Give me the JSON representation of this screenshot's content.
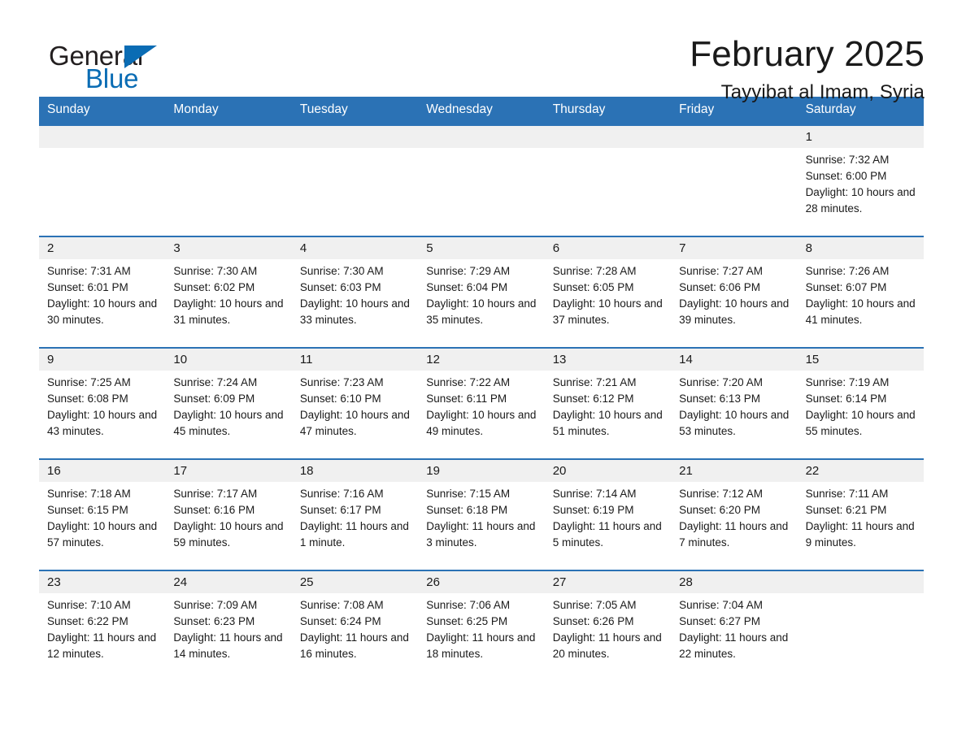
{
  "brand": {
    "name_part1": "General",
    "name_part2": "Blue",
    "logo_icon": "triangle-logo-icon"
  },
  "header": {
    "month_title": "February 2025",
    "location": "Tayyibat al Imam, Syria"
  },
  "colors": {
    "header_blue": "#2b72b5",
    "brand_blue": "#0a6cb4",
    "date_band": "#f0f0f0",
    "text": "#1a1a1a"
  },
  "weekdays": [
    "Sunday",
    "Monday",
    "Tuesday",
    "Wednesday",
    "Thursday",
    "Friday",
    "Saturday"
  ],
  "labels": {
    "sunrise_prefix": "Sunrise:",
    "sunset_prefix": "Sunset:",
    "daylight_prefix": "Daylight:"
  },
  "weeks": [
    [
      {
        "date": "",
        "sunrise": "",
        "sunset": "",
        "daylight": ""
      },
      {
        "date": "",
        "sunrise": "",
        "sunset": "",
        "daylight": ""
      },
      {
        "date": "",
        "sunrise": "",
        "sunset": "",
        "daylight": ""
      },
      {
        "date": "",
        "sunrise": "",
        "sunset": "",
        "daylight": ""
      },
      {
        "date": "",
        "sunrise": "",
        "sunset": "",
        "daylight": ""
      },
      {
        "date": "",
        "sunrise": "",
        "sunset": "",
        "daylight": ""
      },
      {
        "date": "1",
        "sunrise": "Sunrise: 7:32 AM",
        "sunset": "Sunset: 6:00 PM",
        "daylight": "Daylight: 10 hours and 28 minutes."
      }
    ],
    [
      {
        "date": "2",
        "sunrise": "Sunrise: 7:31 AM",
        "sunset": "Sunset: 6:01 PM",
        "daylight": "Daylight: 10 hours and 30 minutes."
      },
      {
        "date": "3",
        "sunrise": "Sunrise: 7:30 AM",
        "sunset": "Sunset: 6:02 PM",
        "daylight": "Daylight: 10 hours and 31 minutes."
      },
      {
        "date": "4",
        "sunrise": "Sunrise: 7:30 AM",
        "sunset": "Sunset: 6:03 PM",
        "daylight": "Daylight: 10 hours and 33 minutes."
      },
      {
        "date": "5",
        "sunrise": "Sunrise: 7:29 AM",
        "sunset": "Sunset: 6:04 PM",
        "daylight": "Daylight: 10 hours and 35 minutes."
      },
      {
        "date": "6",
        "sunrise": "Sunrise: 7:28 AM",
        "sunset": "Sunset: 6:05 PM",
        "daylight": "Daylight: 10 hours and 37 minutes."
      },
      {
        "date": "7",
        "sunrise": "Sunrise: 7:27 AM",
        "sunset": "Sunset: 6:06 PM",
        "daylight": "Daylight: 10 hours and 39 minutes."
      },
      {
        "date": "8",
        "sunrise": "Sunrise: 7:26 AM",
        "sunset": "Sunset: 6:07 PM",
        "daylight": "Daylight: 10 hours and 41 minutes."
      }
    ],
    [
      {
        "date": "9",
        "sunrise": "Sunrise: 7:25 AM",
        "sunset": "Sunset: 6:08 PM",
        "daylight": "Daylight: 10 hours and 43 minutes."
      },
      {
        "date": "10",
        "sunrise": "Sunrise: 7:24 AM",
        "sunset": "Sunset: 6:09 PM",
        "daylight": "Daylight: 10 hours and 45 minutes."
      },
      {
        "date": "11",
        "sunrise": "Sunrise: 7:23 AM",
        "sunset": "Sunset: 6:10 PM",
        "daylight": "Daylight: 10 hours and 47 minutes."
      },
      {
        "date": "12",
        "sunrise": "Sunrise: 7:22 AM",
        "sunset": "Sunset: 6:11 PM",
        "daylight": "Daylight: 10 hours and 49 minutes."
      },
      {
        "date": "13",
        "sunrise": "Sunrise: 7:21 AM",
        "sunset": "Sunset: 6:12 PM",
        "daylight": "Daylight: 10 hours and 51 minutes."
      },
      {
        "date": "14",
        "sunrise": "Sunrise: 7:20 AM",
        "sunset": "Sunset: 6:13 PM",
        "daylight": "Daylight: 10 hours and 53 minutes."
      },
      {
        "date": "15",
        "sunrise": "Sunrise: 7:19 AM",
        "sunset": "Sunset: 6:14 PM",
        "daylight": "Daylight: 10 hours and 55 minutes."
      }
    ],
    [
      {
        "date": "16",
        "sunrise": "Sunrise: 7:18 AM",
        "sunset": "Sunset: 6:15 PM",
        "daylight": "Daylight: 10 hours and 57 minutes."
      },
      {
        "date": "17",
        "sunrise": "Sunrise: 7:17 AM",
        "sunset": "Sunset: 6:16 PM",
        "daylight": "Daylight: 10 hours and 59 minutes."
      },
      {
        "date": "18",
        "sunrise": "Sunrise: 7:16 AM",
        "sunset": "Sunset: 6:17 PM",
        "daylight": "Daylight: 11 hours and 1 minute."
      },
      {
        "date": "19",
        "sunrise": "Sunrise: 7:15 AM",
        "sunset": "Sunset: 6:18 PM",
        "daylight": "Daylight: 11 hours and 3 minutes."
      },
      {
        "date": "20",
        "sunrise": "Sunrise: 7:14 AM",
        "sunset": "Sunset: 6:19 PM",
        "daylight": "Daylight: 11 hours and 5 minutes."
      },
      {
        "date": "21",
        "sunrise": "Sunrise: 7:12 AM",
        "sunset": "Sunset: 6:20 PM",
        "daylight": "Daylight: 11 hours and 7 minutes."
      },
      {
        "date": "22",
        "sunrise": "Sunrise: 7:11 AM",
        "sunset": "Sunset: 6:21 PM",
        "daylight": "Daylight: 11 hours and 9 minutes."
      }
    ],
    [
      {
        "date": "23",
        "sunrise": "Sunrise: 7:10 AM",
        "sunset": "Sunset: 6:22 PM",
        "daylight": "Daylight: 11 hours and 12 minutes."
      },
      {
        "date": "24",
        "sunrise": "Sunrise: 7:09 AM",
        "sunset": "Sunset: 6:23 PM",
        "daylight": "Daylight: 11 hours and 14 minutes."
      },
      {
        "date": "25",
        "sunrise": "Sunrise: 7:08 AM",
        "sunset": "Sunset: 6:24 PM",
        "daylight": "Daylight: 11 hours and 16 minutes."
      },
      {
        "date": "26",
        "sunrise": "Sunrise: 7:06 AM",
        "sunset": "Sunset: 6:25 PM",
        "daylight": "Daylight: 11 hours and 18 minutes."
      },
      {
        "date": "27",
        "sunrise": "Sunrise: 7:05 AM",
        "sunset": "Sunset: 6:26 PM",
        "daylight": "Daylight: 11 hours and 20 minutes."
      },
      {
        "date": "28",
        "sunrise": "Sunrise: 7:04 AM",
        "sunset": "Sunset: 6:27 PM",
        "daylight": "Daylight: 11 hours and 22 minutes."
      },
      {
        "date": "",
        "sunrise": "",
        "sunset": "",
        "daylight": ""
      }
    ]
  ]
}
